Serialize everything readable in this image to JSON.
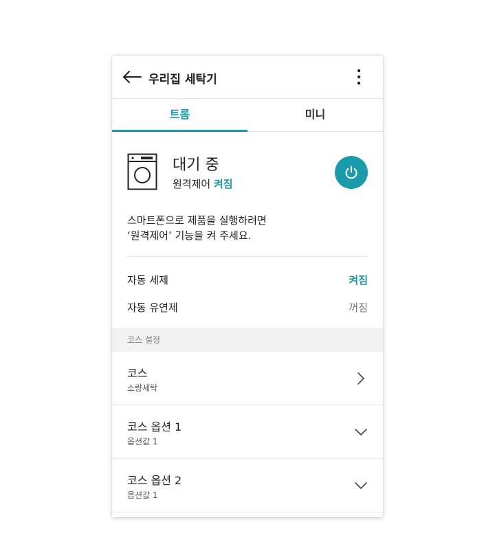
{
  "header": {
    "title": "우리집 세탁기"
  },
  "tabs": [
    {
      "label": "트롬"
    },
    {
      "label": "미니"
    }
  ],
  "status": {
    "title": "대기 중",
    "remote_label": "원격제어",
    "remote_state": "켜짐"
  },
  "description": {
    "line1": "스마트폰으로 제품을 실행하려면",
    "line2": "‘원격제어’ 기능을 켜 주세요."
  },
  "settings": [
    {
      "label": "자동 세제",
      "value": "켜짐"
    },
    {
      "label": "자동 유연제",
      "value": "꺼짐"
    }
  ],
  "section": {
    "label": "코스 설정"
  },
  "rows": [
    {
      "title": "코스",
      "subtitle": "소량세탁",
      "icon": "chevron-right-icon"
    },
    {
      "title": "코스 옵션 1",
      "subtitle": "옵션값 1",
      "icon": "chevron-down-icon"
    },
    {
      "title": "코스 옵션 2",
      "subtitle": "옵션값 1",
      "icon": "chevron-down-icon"
    }
  ],
  "colors": {
    "accent": "#1b9aaa",
    "text": "#222222",
    "muted": "#777777",
    "section_bg": "#f2f2f2"
  }
}
